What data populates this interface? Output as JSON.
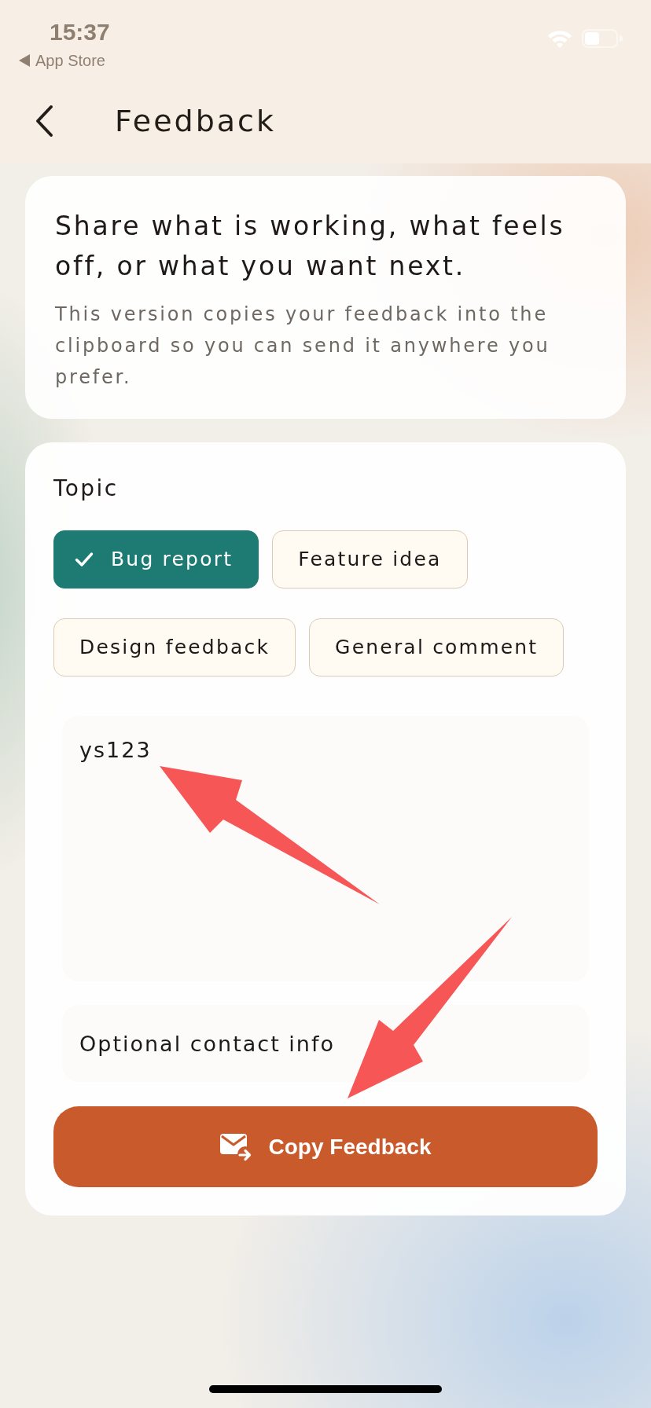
{
  "status_bar": {
    "time": "15:37",
    "back_app": "App Store"
  },
  "header": {
    "title": "Feedback"
  },
  "intro": {
    "heading": "Share what is working, what feels off, or what you want next.",
    "text": "This version copies your feedback into the clipboard so you can send it anywhere you prefer."
  },
  "form": {
    "topic_label": "Topic",
    "topics": [
      {
        "label": "Bug report",
        "selected": true
      },
      {
        "label": "Feature idea",
        "selected": false
      },
      {
        "label": "Design feedback",
        "selected": false
      },
      {
        "label": "General comment",
        "selected": false
      }
    ],
    "message": {
      "value": "ys123"
    },
    "contact": {
      "placeholder": "Optional contact info"
    },
    "submit": {
      "label": "Copy Feedback"
    }
  },
  "annotations": [
    {
      "kind": "arrow"
    },
    {
      "kind": "arrow"
    }
  ]
}
